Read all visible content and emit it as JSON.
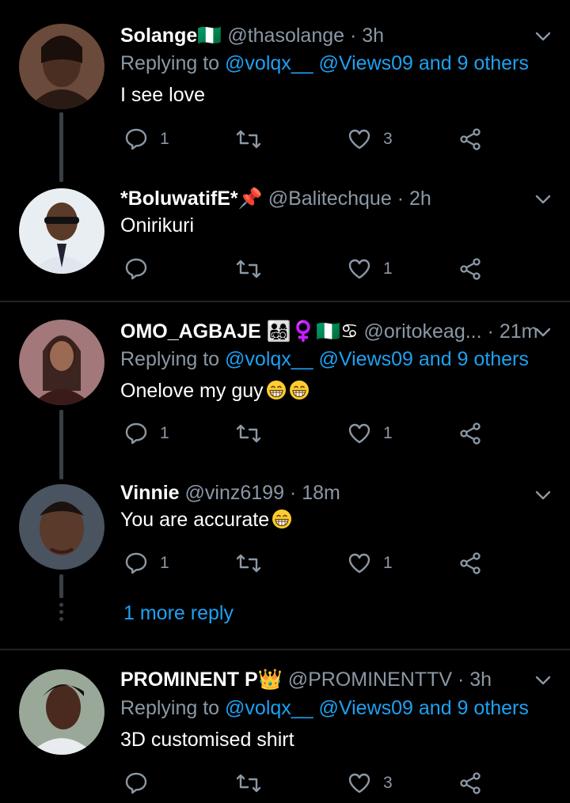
{
  "tweets": [
    {
      "name": "Solange🇳🇬",
      "handle": "@thasolange",
      "sep": "·",
      "time": "3h",
      "replying_prefix": "Replying to ",
      "replying_mentions": "@volqx__ @Views09 and 9 others",
      "text": "I see love",
      "replies": "1",
      "retweets": "",
      "likes": "3"
    },
    {
      "name": "*BoluwatifE*📌",
      "handle": "@Balitechque",
      "sep": "·",
      "time": "2h",
      "text": "Onirikuri",
      "replies": "",
      "retweets": "",
      "likes": "1"
    },
    {
      "name": "OMO_AGBAJE 👨‍👩‍👧‍👦♀️🇳🇬♋",
      "handle": "@oritokeag...",
      "sep": "·",
      "time": "21m",
      "replying_prefix": "Replying to ",
      "replying_mentions": "@volqx__ @Views09 and 9 others",
      "text": "Onelove my guy",
      "replies": "1",
      "retweets": "",
      "likes": "1"
    },
    {
      "name": "Vinnie",
      "handle": "@vinz6199",
      "sep": "·",
      "time": "18m",
      "text": "You are accurate",
      "replies": "1",
      "retweets": "",
      "likes": "1"
    },
    {
      "name": "PROMINENT P👑",
      "handle": "@PROMINENTTV",
      "sep": "·",
      "time": "3h",
      "replying_prefix": "Replying to ",
      "replying_mentions": "@volqx__ @Views09 and 9 others",
      "text": "3D customised shirt",
      "replies": "",
      "retweets": "",
      "likes": "3"
    }
  ],
  "more_reply": "1 more reply",
  "colors": {
    "background": "#000000",
    "accent": "#1da1f2",
    "muted": "#8b98a5",
    "divider": "#1f2327"
  },
  "icons": [
    "reply-icon",
    "retweet-icon",
    "like-icon",
    "share-icon",
    "chevron-down-icon",
    "grin-emoji-icon"
  ]
}
